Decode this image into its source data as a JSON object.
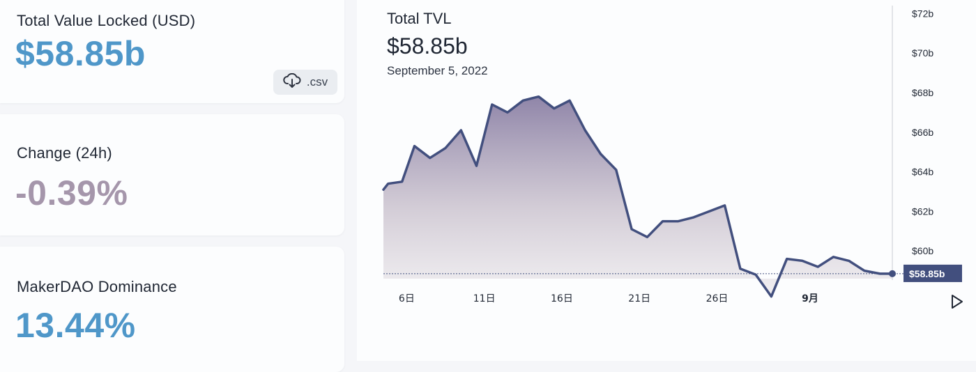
{
  "cards": [
    {
      "label": "Total Value Locked (USD)",
      "value": "$58.85b",
      "color": "#4f97c9"
    },
    {
      "label": "Change (24h)",
      "value": "-0.39%",
      "color": "#a596ab"
    },
    {
      "label": "MakerDAO Dominance",
      "value": "13.44%",
      "color": "#4f97c9"
    }
  ],
  "csv_button": {
    "label": ".csv",
    "icon": "cloud-download-icon"
  },
  "chart_header": {
    "title": "Total TVL",
    "value": "$58.85b",
    "date": "September 5, 2022"
  },
  "chart_data": {
    "type": "area",
    "title": "Total TVL",
    "xlabel": "",
    "ylabel": "",
    "x_tick_labels": [
      "6日",
      "11日",
      "16日",
      "21日",
      "26日",
      "9月"
    ],
    "x_tick_days": [
      6,
      11,
      16,
      21,
      26,
      32
    ],
    "y_tick_labels": [
      "$60b",
      "$62b",
      "$64b",
      "$66b",
      "$68b",
      "$70b",
      "$72b"
    ],
    "y_tick_values": [
      60,
      62,
      64,
      66,
      68,
      70,
      72
    ],
    "ylim": [
      58.6,
      72.4
    ],
    "xlim_days": [
      4.5,
      37.3
    ],
    "grid": false,
    "series": [
      {
        "x_days": [
          4.5,
          4.8,
          5.7,
          6.5,
          7.5,
          8.5,
          9.5,
          10.5,
          11.5,
          12.5,
          13.5,
          14.5,
          15.5,
          16.5,
          17.5,
          18.5,
          19.5,
          20.5,
          21.5,
          22.5,
          23.5,
          24.5,
          25.5,
          26.5,
          27.5,
          28.5,
          29.5,
          30.5,
          31.5,
          32.5,
          33.5,
          34.5,
          35.5,
          36.5,
          37.3
        ],
        "values": [
          63.1,
          63.4,
          63.5,
          65.3,
          64.7,
          65.2,
          66.1,
          64.3,
          67.4,
          67.0,
          67.6,
          67.8,
          67.2,
          67.6,
          66.1,
          64.9,
          64.1,
          61.1,
          60.7,
          61.5,
          61.5,
          61.7,
          62.0,
          62.3,
          59.1,
          58.8,
          57.7,
          59.6,
          59.5,
          59.2,
          59.7,
          59.5,
          59.0,
          58.85,
          58.85
        ]
      }
    ],
    "current_value_label": "$58.85b",
    "line_color": "#424f7e"
  },
  "play_button": {
    "icon": "play-icon"
  }
}
